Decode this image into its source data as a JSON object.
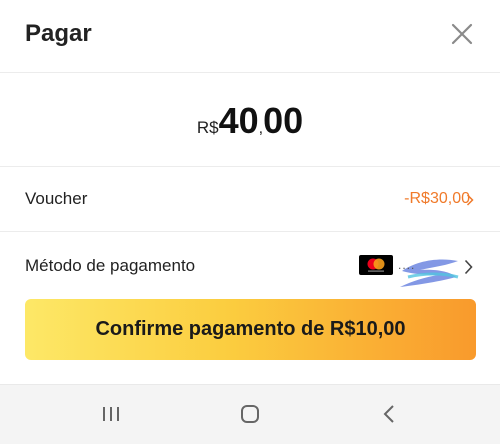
{
  "header": {
    "title": "Pagar",
    "close_icon": "close-icon"
  },
  "amount": {
    "currency": "R$",
    "integer": "40",
    "separator": ",",
    "decimals": "00"
  },
  "voucher": {
    "label": "Voucher",
    "value": "-R$30,00",
    "value_color": "#f07a2a",
    "chevron_icon": "chevron-right-icon"
  },
  "payment_method": {
    "label": "Método de pagamento",
    "card_icon": "mastercard-icon",
    "chevron_icon": "chevron-right-icon"
  },
  "confirm_button": {
    "label": "Confirme pagamento de R$10,00",
    "gradient": [
      "#fde867",
      "#f99a2c"
    ]
  },
  "system_nav": {
    "recents_icon": "recents-icon",
    "home_icon": "home-icon",
    "back_icon": "back-icon"
  }
}
